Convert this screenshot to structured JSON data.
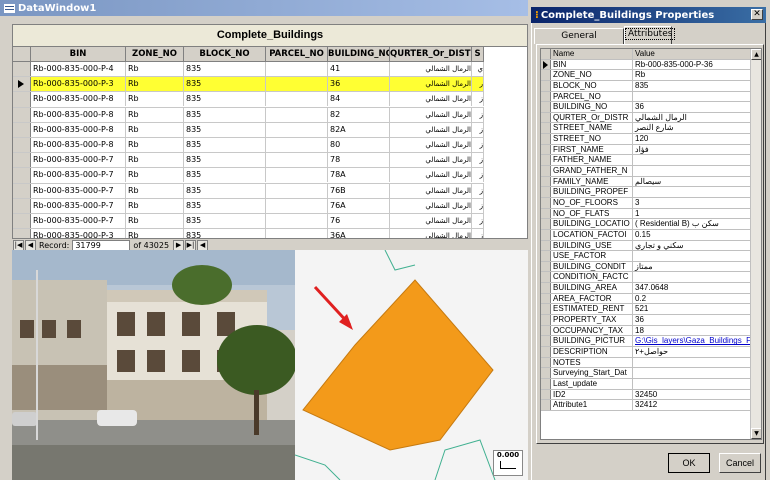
{
  "datawindow": {
    "title": "DataWindow1"
  },
  "table": {
    "caption": "Complete_Buildings",
    "columns": [
      "BIN",
      "ZONE_NO",
      "BLOCK_NO",
      "PARCEL_NO",
      "BUILDING_NO",
      "QURTER_Or_DISTRICT",
      "S"
    ],
    "rows": [
      [
        "Rb-000-835-000-P-4",
        "Rb",
        "835",
        "",
        "41",
        "الرمال الشمالي",
        "ي"
      ],
      [
        "Rb-000-835-000-P-3",
        "Rb",
        "835",
        "",
        "36",
        "الرمال الشمالي",
        "ر"
      ],
      [
        "Rb-000-835-000-P-8",
        "Rb",
        "835",
        "",
        "84",
        "الرمال الشمالي",
        "ز"
      ],
      [
        "Rb-000-835-000-P-8",
        "Rb",
        "835",
        "",
        "82",
        "الرمال الشمالي",
        "ز"
      ],
      [
        "Rb-000-835-000-P-8",
        "Rb",
        "835",
        "",
        "82A",
        "الرمال الشمالي",
        "ز"
      ],
      [
        "Rb-000-835-000-P-8",
        "Rb",
        "835",
        "",
        "80",
        "الرمال الشمالي",
        "ز"
      ],
      [
        "Rb-000-835-000-P-7",
        "Rb",
        "835",
        "",
        "78",
        "الرمال الشمالي",
        "ز"
      ],
      [
        "Rb-000-835-000-P-7",
        "Rb",
        "835",
        "",
        "78A",
        "الرمال الشمالي",
        "ز"
      ],
      [
        "Rb-000-835-000-P-7",
        "Rb",
        "835",
        "",
        "76B",
        "الرمال الشمالي",
        "ز"
      ],
      [
        "Rb-000-835-000-P-7",
        "Rb",
        "835",
        "",
        "76A",
        "الرمال الشمالي",
        "ز"
      ],
      [
        "Rb-000-835-000-P-7",
        "Rb",
        "835",
        "",
        "76",
        "الرمال الشمالي",
        "ز"
      ],
      [
        "Rb-000-835-000-P-3",
        "Rb",
        "835",
        "",
        "36A",
        "الرمال الشمالي",
        "ز"
      ]
    ],
    "selected_row": 1
  },
  "navigator": {
    "record_label": "Record:",
    "record_value": "31799",
    "of_label": "of 43025"
  },
  "map": {
    "scale_label": "0.000"
  },
  "properties": {
    "title": "Complete_Buildings Properties",
    "tabs": [
      "General",
      "Attributes"
    ],
    "header": [
      "Name",
      "Value"
    ],
    "attributes": [
      [
        "BIN",
        "Rb-000-835-000-P-36"
      ],
      [
        "ZONE_NO",
        "Rb"
      ],
      [
        "BLOCK_NO",
        "835"
      ],
      [
        "PARCEL_NO",
        ""
      ],
      [
        "BUILDING_NO",
        "36"
      ],
      [
        "QURTER_Or_DISTR",
        "الرمال الشمالي"
      ],
      [
        "STREET_NAME",
        "شارع النصر"
      ],
      [
        "STREET_NO",
        "120"
      ],
      [
        "FIRST_NAME",
        "فؤاد"
      ],
      [
        "FATHER_NAME",
        ""
      ],
      [
        "GRAND_FATHER_N",
        ""
      ],
      [
        "FAMILY_NAME",
        "سيصالم"
      ],
      [
        "BUILDING_PROPEF",
        ""
      ],
      [
        "NO_OF_FLOORS",
        "3"
      ],
      [
        "NO_OF_FLATS",
        "1"
      ],
      [
        "BUILDING_LOCATIO",
        "( Residential B) سكن ب"
      ],
      [
        "LOCATION_FACTOI",
        "0.15"
      ],
      [
        "BUILDING_USE",
        "سكني و تجاري"
      ],
      [
        "USE_FACTOR",
        ""
      ],
      [
        "BUILDING_CONDIT",
        "ممتاز"
      ],
      [
        "CONDITION_FACTC",
        ""
      ],
      [
        "BUILDING_AREA",
        "347.0648"
      ],
      [
        "AREA_FACTOR",
        "0.2"
      ],
      [
        "ESTIMATED_RENT",
        "521"
      ],
      [
        "PROPERTY_TAX",
        "36"
      ],
      [
        "OCCUPANCY_TAX",
        "18"
      ],
      [
        "BUILDING_PICTUR",
        "G:\\Gis_layers\\Gaza_Buildings_F"
      ],
      [
        "DESCRIPTION",
        "حواصل+٢"
      ],
      [
        "NOTES",
        ""
      ],
      [
        "Surveying_Start_Dat",
        ""
      ],
      [
        "Last_update",
        ""
      ],
      [
        "ID2",
        "32450"
      ],
      [
        "Attribute1",
        "32412"
      ]
    ],
    "ok_label": "OK",
    "cancel_label": "Cancel"
  }
}
